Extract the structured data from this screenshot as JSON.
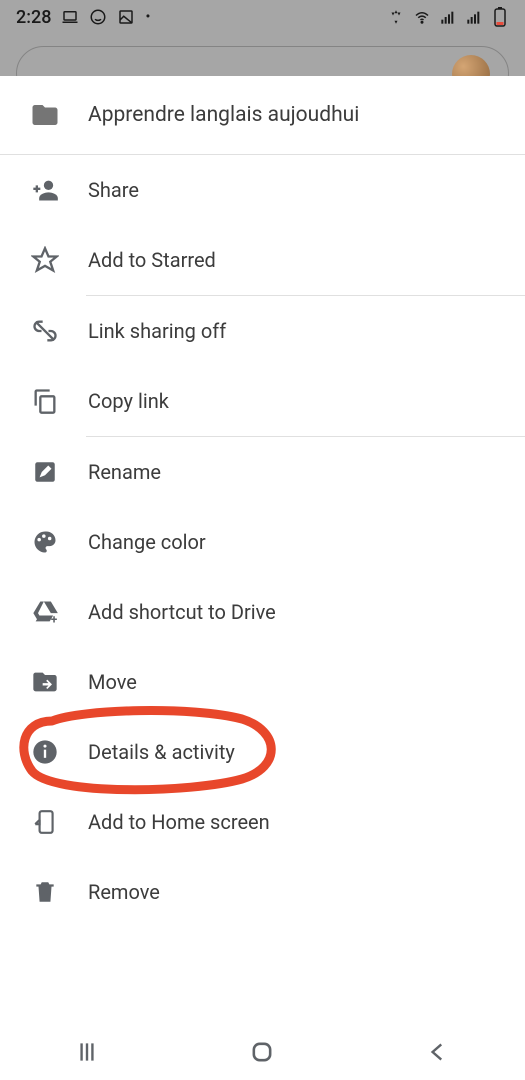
{
  "status_bar": {
    "time": "2:28"
  },
  "sheet": {
    "title": "Apprendre langlais aujoudhui",
    "items": [
      {
        "label": "Share"
      },
      {
        "label": "Add to Starred"
      },
      {
        "label": "Link sharing off"
      },
      {
        "label": "Copy link"
      },
      {
        "label": "Rename"
      },
      {
        "label": "Change color"
      },
      {
        "label": "Add shortcut to Drive"
      },
      {
        "label": "Move"
      },
      {
        "label": "Details & activity"
      },
      {
        "label": "Add to Home screen"
      },
      {
        "label": "Remove"
      }
    ]
  }
}
